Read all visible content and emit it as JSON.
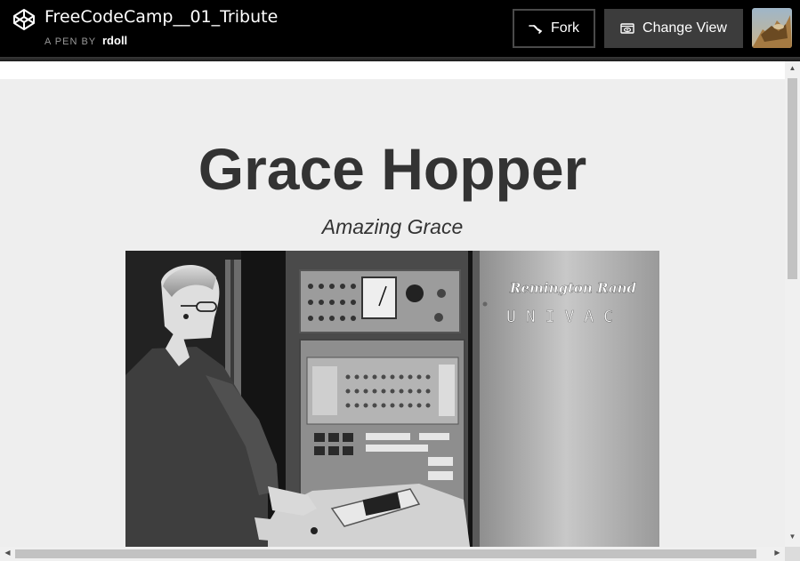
{
  "header": {
    "pen_title": "FreeCodeCamp__01_Tribute",
    "pen_by_label": "A PEN BY",
    "author": "rdoll",
    "fork_label": "Fork",
    "change_view_label": "Change View",
    "bg_color": "#000000"
  },
  "content": {
    "title": "Grace Hopper",
    "subtitle": "Amazing Grace",
    "photo_text_brand": "Remington Rand",
    "photo_text_model": "UNIVAC",
    "background_color": "#eeeeee",
    "text_color": "#333333"
  },
  "icons": {
    "logo": "codepen-logo-icon",
    "fork": "fork-icon",
    "change_view": "eye-icon",
    "avatar": "user-avatar"
  }
}
